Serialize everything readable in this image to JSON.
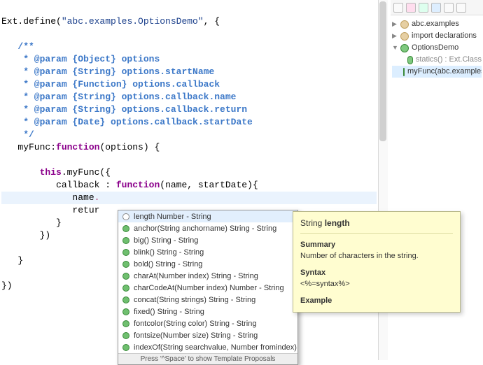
{
  "code": {
    "define_fn": "Ext.define",
    "class_name": "\"abc.examples.OptionsDemo\"",
    "doc_open": "/**",
    "doc_l1": " * @param {Object} options",
    "doc_l2": " * @param {String} options.startName",
    "doc_l3": " * @param {Function} options.callback",
    "doc_l4": " * @param {String} options.callback.name",
    "doc_l5": " * @param {String} options.callback.return",
    "doc_l6": " * @param {Date} options.callback.startDate",
    "doc_close": " */",
    "fn_name": "myFunc",
    "kw_function": "function",
    "fn_params": "(options) {",
    "call_line_a": "this",
    "call_line_b": ".myFunc({",
    "cb_key": "callback",
    "cb_sep": " : ",
    "cb_params": "(name, startDate){",
    "name_tok": "name",
    "retur_tok": "retur",
    "close1": "}",
    "close2": "})",
    "close3": "}",
    "close4": "})"
  },
  "autocomplete": {
    "items": [
      {
        "kind": "prop",
        "label": "length Number - String",
        "selected": true
      },
      {
        "kind": "method",
        "label": "anchor(String anchorname) String - String"
      },
      {
        "kind": "method",
        "label": "big() String - String"
      },
      {
        "kind": "method",
        "label": "blink() String - String"
      },
      {
        "kind": "method",
        "label": "bold() String - String"
      },
      {
        "kind": "method",
        "label": "charAt(Number index) String - String"
      },
      {
        "kind": "method",
        "label": "charCodeAt(Number index) Number - String"
      },
      {
        "kind": "method",
        "label": "concat(String strings) String - String"
      },
      {
        "kind": "method",
        "label": "fixed() String - String"
      },
      {
        "kind": "method",
        "label": "fontcolor(String color) String - String"
      },
      {
        "kind": "method",
        "label": "fontsize(Number size) String - String"
      },
      {
        "kind": "method",
        "label": "indexOf(String searchvalue, Number fromindex) Numb…"
      }
    ],
    "status_hint": "Press '^Space' to show Template Proposals"
  },
  "doc_panel": {
    "title_prefix": "String ",
    "title_member": "length",
    "summary_h": "Summary",
    "summary_txt": "Number of characters in the string.",
    "syntax_h": "Syntax",
    "syntax_txt": "<%=syntax%>",
    "example_h": "Example"
  },
  "outline": {
    "tree": [
      {
        "level": 0,
        "twisty": "▶",
        "icon": "pkg",
        "label": "abc.examples",
        "selected": false
      },
      {
        "level": 0,
        "twisty": "▶",
        "icon": "pkg",
        "label": "import declarations",
        "selected": false
      },
      {
        "level": 0,
        "twisty": "▼",
        "icon": "class",
        "label": "OptionsDemo",
        "selected": false
      },
      {
        "level": 1,
        "twisty": "",
        "icon": "method",
        "label": "statics() : Ext.Class",
        "selected": false,
        "faint": true
      },
      {
        "level": 1,
        "twisty": "",
        "icon": "method",
        "label": "myFunc(abc.examples.Op",
        "selected": true
      }
    ]
  }
}
